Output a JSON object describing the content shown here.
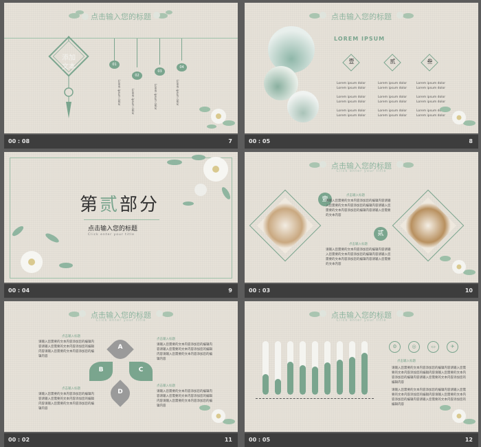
{
  "colors": {
    "accent": "#7aa58e",
    "bg": "#e6e1d8",
    "bar": "#3d3d3d",
    "frame": "#5c5c5c"
  },
  "slides": [
    {
      "duration": "00 : 08",
      "number": "7",
      "header": "点击输入您的标题",
      "kite_text": "添加\n文本",
      "tags": [
        "01",
        "02",
        "03",
        "04"
      ],
      "vertical_text": "Lorem ipsum dolor"
    },
    {
      "duration": "00 : 05",
      "number": "8",
      "header": "点击输入您的标题",
      "title": "LOREM  IPSUM",
      "items": [
        "壹",
        "贰",
        "叁"
      ],
      "lorem_line": "Lorem ipsum dolor"
    },
    {
      "duration": "00 : 04",
      "number": "9",
      "title_a": "第",
      "title_b": "贰",
      "title_c": "部分",
      "subtitle": "点击输入您的标题",
      "subtitle_en": "Click  enter  your  title"
    },
    {
      "duration": "00 : 03",
      "number": "10",
      "header": "点击输入您的标题",
      "header_en": "Click  enter  your  title",
      "labels": [
        "壹",
        "贰"
      ],
      "sub_label": "点击输入标题",
      "para": "请输入您需要的文本内容添加您的编辑内容请输入您需要的文本内容添加您的编辑内容请输入您需要的文本内容添加您的编辑内容请输入您需要的文本内容"
    },
    {
      "duration": "00 : 02",
      "number": "11",
      "header": "点击输入您的标题",
      "header_en": "Click  enter  your  title",
      "petals": [
        "A",
        "B",
        "C",
        "D"
      ],
      "sub_label": "点击输入标题",
      "para": "请输入您需要的文本内容添加您的编辑内容请输入您需要的文本内容添加您的编辑内容请输入您需要的文本内容添加您的编辑内容"
    },
    {
      "duration": "00 : 05",
      "number": "12",
      "header": "点击输入您的标题",
      "header_en": "Click  enter  your  title",
      "sub_label": "点击输入标题",
      "para": "请输入您需要的文本内容添加您的编辑内容请输入您需要的文本内容添加您的编辑内容请输入您需要的文本内容添加您的编辑内容请输入您需要的文本内容添加您的编辑内容",
      "bar_levels": [
        0.38,
        0.3,
        0.62,
        0.55,
        0.52,
        0.6,
        0.65,
        0.7,
        0.78
      ]
    }
  ]
}
